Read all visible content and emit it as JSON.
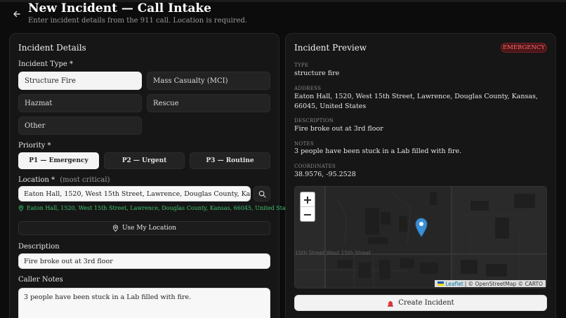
{
  "header": {
    "title": "New Incident — Call Intake",
    "subtitle": "Enter incident details from the 911 call. Location is required."
  },
  "details": {
    "title": "Incident Details",
    "type_label": "Incident Type *",
    "types": [
      "Structure Fire",
      "Mass Casualty (MCI)",
      "Hazmat",
      "Rescue",
      "Other"
    ],
    "selected_type": "Structure Fire",
    "priority_label": "Priority *",
    "priorities": [
      "P1 — Emergency",
      "P2 — Urgent",
      "P3 — Routine"
    ],
    "selected_priority": "P1 — Emergency",
    "location_label": "Location *",
    "location_hint": "(most critical)",
    "location_value": "Eaton Hall, 1520, West 15th Street, Lawrence, Douglas County, Kansas, 66045, United States",
    "location_resolved": "Eaton Hall, 1520, West 15th Street, Lawrence, Douglas County, Kansas, 66045, United States",
    "use_location_label": "Use My Location",
    "description_label": "Description",
    "description_value": "Fire broke out at 3rd floor",
    "notes_label": "Caller Notes",
    "notes_value": "3 people have been stuck in a Lab filled with fire."
  },
  "preview": {
    "title": "Incident Preview",
    "badge": "EMERGENCY",
    "type_label": "TYPE",
    "type_value": "structure fire",
    "address_label": "ADDRESS",
    "address_value": "Eaton Hall, 1520, West 15th Street, Lawrence, Douglas County, Kansas, 66045, United States",
    "description_label": "DESCRIPTION",
    "description_value": "Fire broke out at 3rd floor",
    "notes_label": "NOTES",
    "notes_value": "3 people have been stuck in a Lab filled with fire.",
    "coords_label": "COORDINATES",
    "coords_value": "38.9576, -95.2528"
  },
  "map": {
    "zoom_in": "+",
    "zoom_out": "−",
    "street_label": "15th Street West 15th Street",
    "attribution_leaflet": "Leaflet",
    "attribution_rest": "| © OpenStreetMap © CARTO"
  },
  "create_button": "Create Incident",
  "colors": {
    "accent_green": "#3ec46d",
    "emergency_red": "#ff6b6b",
    "marker_blue": "#3a8fd6"
  }
}
